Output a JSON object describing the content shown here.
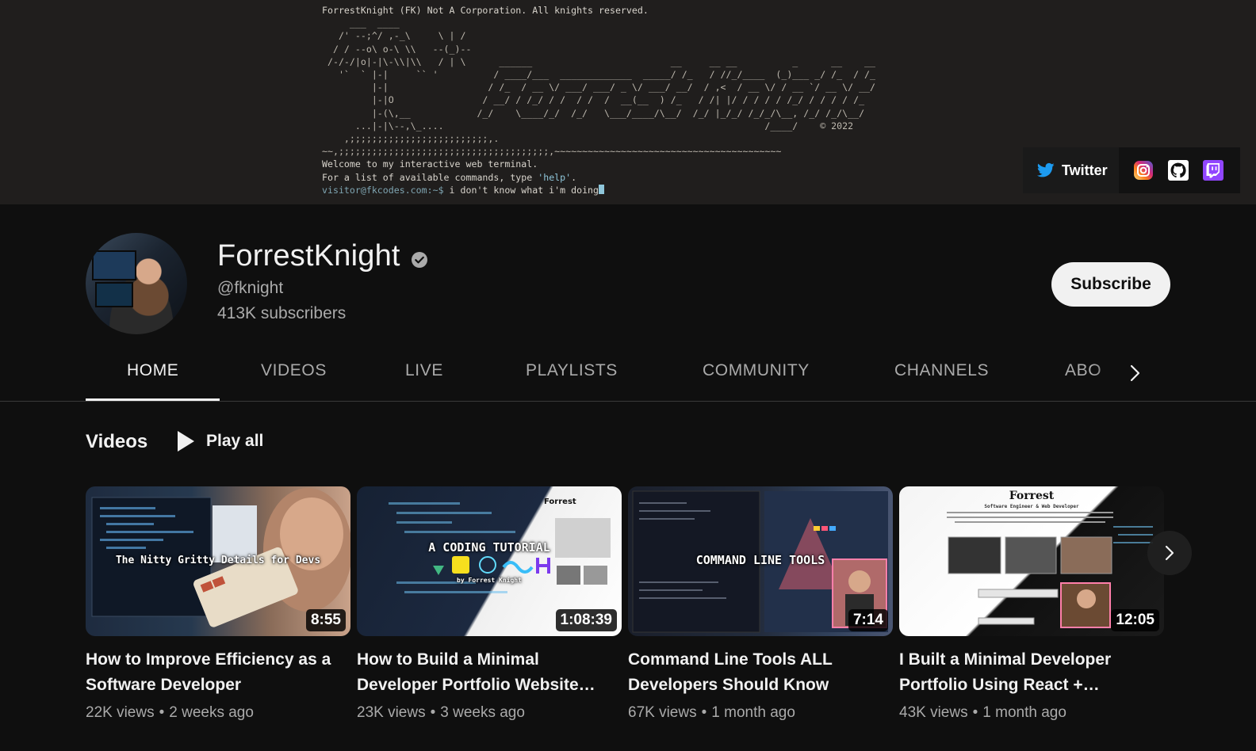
{
  "banner": {
    "copyright_line": "ForrestKnight (FK) Not A Corporation. All knights reserved.",
    "ascii_art": "     ___  ____\n   /' --;^/ ,-_\\     \\ | /\n  / / --o\\ o-\\ \\\\   --(_)--\n /-/-/|o|-|\\-\\\\|\\\\   / | \\      ______                         __     __ __          _      __    __\n   '`  ` |-|     `` '          / ____/___  _____________  _____/ /_   / //_/____  (_)___ _/ /_  / /_\n         |-|                  / /_  / __ \\/ ___/ ___/ _ \\/ ___/ __/  / ,<  / __ \\/ / __ `/ __ \\/ __/\n         |-|O                / __/ / /_/ / /  / /  /  __(__  ) /_   / /| |/ / / / / /_/ / / / / /_\n         |-(\\,__            /_/    \\____/_/  /_/   \\___/____/\\__/  /_/ |_/_/ /_/_/\\__, /_/ /_/\\__/\n      ...|-|\\--,\\_....                                                          /____/    © 2022\n    ,;;;;;;;;;;;;;;;;;;;;;;;;;,.",
    "wave_line": "~~,;;;;;;;;;;;;;;;;;;;;;;;;;;;;;;;;;;;;;;,~~~~~~~~~~~~~~~~~~~~~~~~~~~~~~~~~~~~~~~~~",
    "welcome_line": "Welcome to my interactive web terminal.",
    "help_prefix": "For a list of available commands, type ",
    "help_cmd": "'help'",
    "help_suffix": ".",
    "prompt": "visitor@fkcodes.com:~$",
    "typed_command": " i don't know what i'm doing",
    "twitter_label": "Twitter",
    "icons": [
      "twitter-icon",
      "instagram-icon",
      "github-icon",
      "twitch-icon"
    ]
  },
  "channel": {
    "name": "ForrestKnight",
    "handle": "@fknight",
    "subscribers": "413K subscribers",
    "subscribe_label": "Subscribe"
  },
  "tabs": [
    {
      "label": "HOME",
      "active": true
    },
    {
      "label": "VIDEOS"
    },
    {
      "label": "LIVE"
    },
    {
      "label": "PLAYLISTS"
    },
    {
      "label": "COMMUNITY"
    },
    {
      "label": "CHANNELS"
    },
    {
      "label": "ABOUT"
    }
  ],
  "shelf": {
    "title": "Videos",
    "play_all": "Play all"
  },
  "videos": [
    {
      "thumb_text": "The Nitty Gritty Details for Devs",
      "duration": "8:55",
      "title": "How to Improve Efficiency as a Software Developer",
      "views": "22K views",
      "age": "2 weeks ago"
    },
    {
      "thumb_text": "A CODING TUTORIAL",
      "thumb_sub": "by Forrest Knight",
      "thumb_name": "Forrest",
      "duration": "1:08:39",
      "title": "How to Build a Minimal Developer Portfolio Website…",
      "views": "23K views",
      "age": "3 weeks ago"
    },
    {
      "thumb_text": "COMMAND LINE TOOLS",
      "duration": "7:14",
      "title": "Command Line Tools ALL Developers Should Know",
      "views": "67K views",
      "age": "1 month ago"
    },
    {
      "thumb_text": "Forrest",
      "thumb_sub": "Software Engineer & Web Developer",
      "duration": "12:05",
      "title": "I Built a Minimal Developer Portfolio Using React +…",
      "views": "43K views",
      "age": "1 month ago"
    }
  ],
  "colors": {
    "background": "#0f0f0f",
    "banner": "#201e1d",
    "text_primary": "#f1f1f1",
    "text_secondary": "#aaaaaa",
    "twitter_blue": "#1d9bf0",
    "twitch_purple": "#9146ff"
  }
}
